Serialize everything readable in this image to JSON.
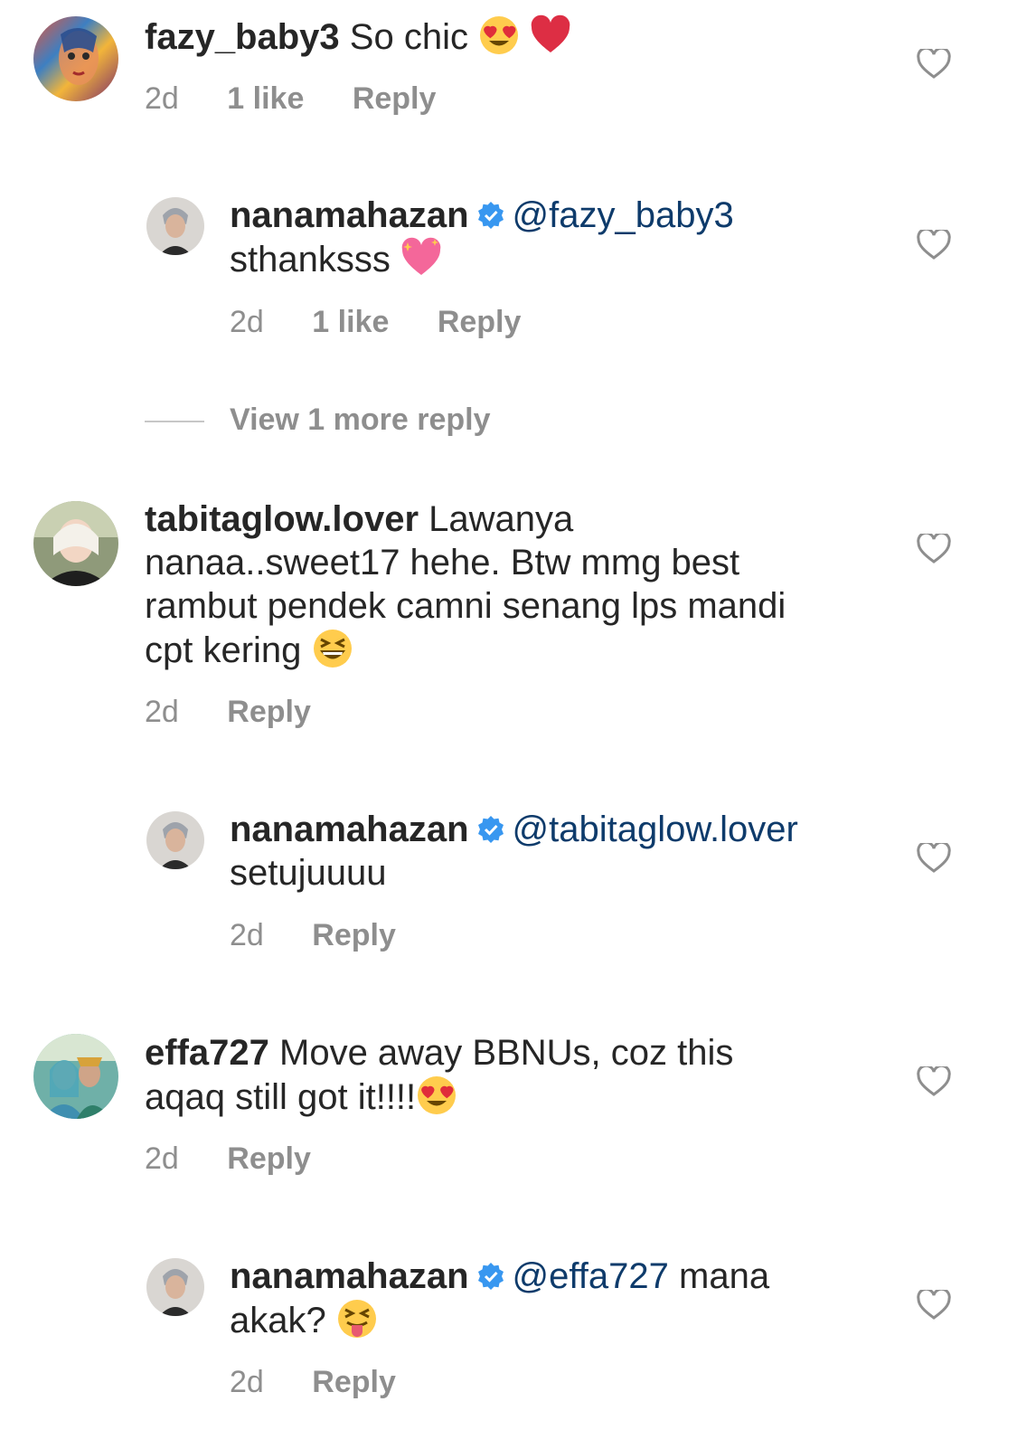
{
  "comments": [
    {
      "username": "fazy_baby3",
      "text": "So chic",
      "emojis": [
        "heart-eyes-emoji",
        "red-heart-emoji"
      ],
      "time": "2d",
      "likes": "1 like",
      "reply": "Reply"
    },
    {
      "username": "nanamahazan",
      "mention": "@fazy_baby3",
      "text_line2": "sthanksss",
      "emojis": [
        "sparkling-heart-emoji"
      ],
      "time": "2d",
      "likes": "1 like",
      "reply": "Reply"
    },
    {
      "username": "tabitaglow.lover",
      "text_line1": "Lawanya",
      "text_line2": "nanaa..sweet17 hehe. Btw mmg best",
      "text_line3": "rambut pendek camni senang lps mandi",
      "text_line4": "cpt kering",
      "emojis": [
        "grinning-squinting-emoji"
      ],
      "time": "2d",
      "reply": "Reply"
    },
    {
      "username": "nanamahazan",
      "mention": "@tabitaglow.lover",
      "text_line2": "setujuuuu",
      "time": "2d",
      "reply": "Reply"
    },
    {
      "username": "effa727",
      "text_line1": "Move away BBNUs, coz this",
      "text_line2": "aqaq still got it!!!!",
      "emojis": [
        "heart-eyes-emoji"
      ],
      "time": "2d",
      "reply": "Reply"
    },
    {
      "username": "nanamahazan",
      "mention": "@effa727",
      "text_line1": "mana",
      "text_line2": "akak?",
      "emojis": [
        "squinting-tongue-emoji"
      ],
      "time": "2d",
      "reply": "Reply"
    }
  ],
  "view_more": "View 1 more reply",
  "colors": {
    "text": "#262626",
    "meta": "#8e8e8e",
    "mention": "#0e3b6b",
    "verified": "#3897f0"
  }
}
